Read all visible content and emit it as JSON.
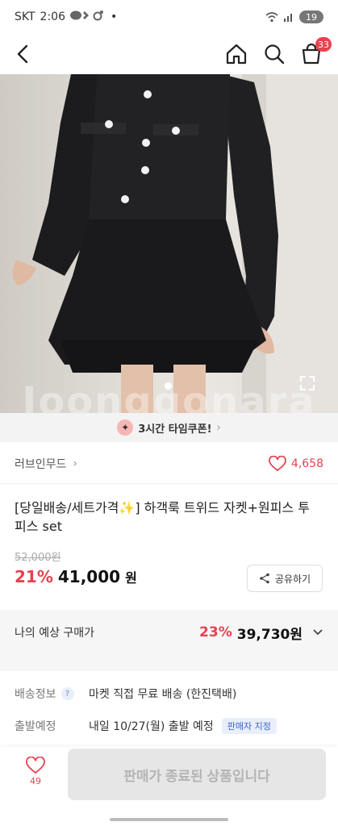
{
  "status": {
    "carrier": "SKT",
    "time": "2:06",
    "battery": "19",
    "indicators": "•"
  },
  "nav": {
    "cart_count": "33",
    "icons": [
      "back-icon",
      "home-icon",
      "search-icon",
      "cart-icon"
    ]
  },
  "hero": {
    "watermark": "Joonggonara"
  },
  "coupon": {
    "label": "3시간 타임쿠폰!",
    "chevron": "›"
  },
  "shop": {
    "name": "러브인무드",
    "chevron": "›",
    "likes": "4,658"
  },
  "product": {
    "title": "[당일배송/세트가격✨] 하객룩 트위드 자켓+원피스 투피스 set",
    "original_price": "52,000원",
    "discount": "21%",
    "price": "41,000",
    "currency": "원",
    "share_label": "공유하기"
  },
  "expected": {
    "label": "나의 예상 구매가",
    "discount": "23%",
    "price": "39,730원"
  },
  "info": {
    "shipping_label": "배송정보",
    "shipping_help": "?",
    "shipping_value": "마켓 직접 무료 배송 (한진택배)",
    "departure_label": "출발예정",
    "departure_value": "내일 10/27(월) 출발 예정",
    "departure_tag": "판매자 지정"
  },
  "bottom": {
    "wish_count": "49",
    "buy_label": "판매가 종료된 상품입니다"
  },
  "colors": {
    "accent": "#e8414e",
    "tag_blue": "#3c64c9"
  }
}
